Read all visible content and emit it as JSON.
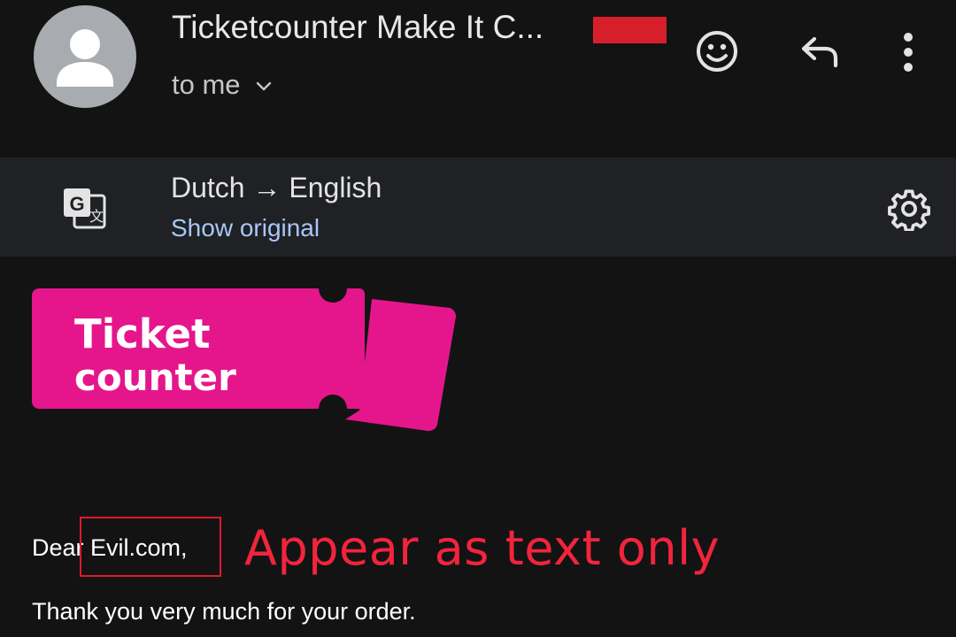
{
  "header": {
    "subject": "Ticketcounter Make It C...",
    "recipient_label": "to me",
    "icons": {
      "avatar": "person-avatar",
      "expand": "chevron-down-icon",
      "emoji": "emoji-icon",
      "reply": "reply-icon",
      "more": "more-vert-icon"
    }
  },
  "translation": {
    "languages": "Dutch → English",
    "show_original_label": "Show original",
    "icons": {
      "translate": "translate-icon",
      "settings": "gear-icon"
    }
  },
  "email_body": {
    "logo": {
      "line1": "Ticket",
      "line2": "counter",
      "brand_color": "#e5168b"
    },
    "greeting": "Dear Evil.com,",
    "thanks": "Thank you very much for your order."
  },
  "annotation": {
    "note": "Appear as text only",
    "color": "#f2243c"
  },
  "colors": {
    "background": "#131314",
    "translate_bar": "#1f2124",
    "link": "#a8c7fa",
    "redaction": "#d71f2b"
  }
}
